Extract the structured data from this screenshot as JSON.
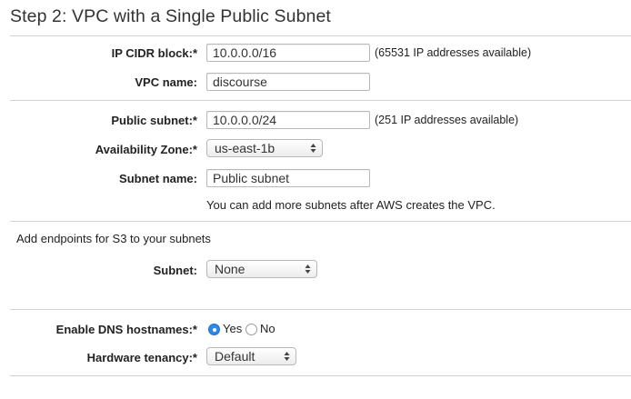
{
  "title": "Step 2: VPC with a Single Public Subnet",
  "vpc": {
    "cidr_label": "IP CIDR block:*",
    "cidr_value": "10.0.0.0/16",
    "cidr_note": "(65531 IP addresses available)",
    "name_label": "VPC name:",
    "name_value": "discourse"
  },
  "subnet": {
    "public_label": "Public subnet:*",
    "public_value": "10.0.0.0/24",
    "public_note": "(251 IP addresses available)",
    "az_label": "Availability Zone:*",
    "az_value": "us-east-1b",
    "name_label": "Subnet name:",
    "name_value": "Public subnet",
    "hint": "You can add more subnets after AWS creates the VPC."
  },
  "endpoints": {
    "heading": "Add endpoints for S3 to your subnets",
    "subnet_label": "Subnet:",
    "subnet_value": "None"
  },
  "options": {
    "dns_label": "Enable DNS hostnames:*",
    "dns_yes": "Yes",
    "dns_no": "No",
    "dns_selected": "Yes",
    "tenancy_label": "Hardware tenancy:*",
    "tenancy_value": "Default"
  },
  "colors": {
    "radio_selected": "#2f88ea",
    "divider": "#d2d2d2"
  }
}
